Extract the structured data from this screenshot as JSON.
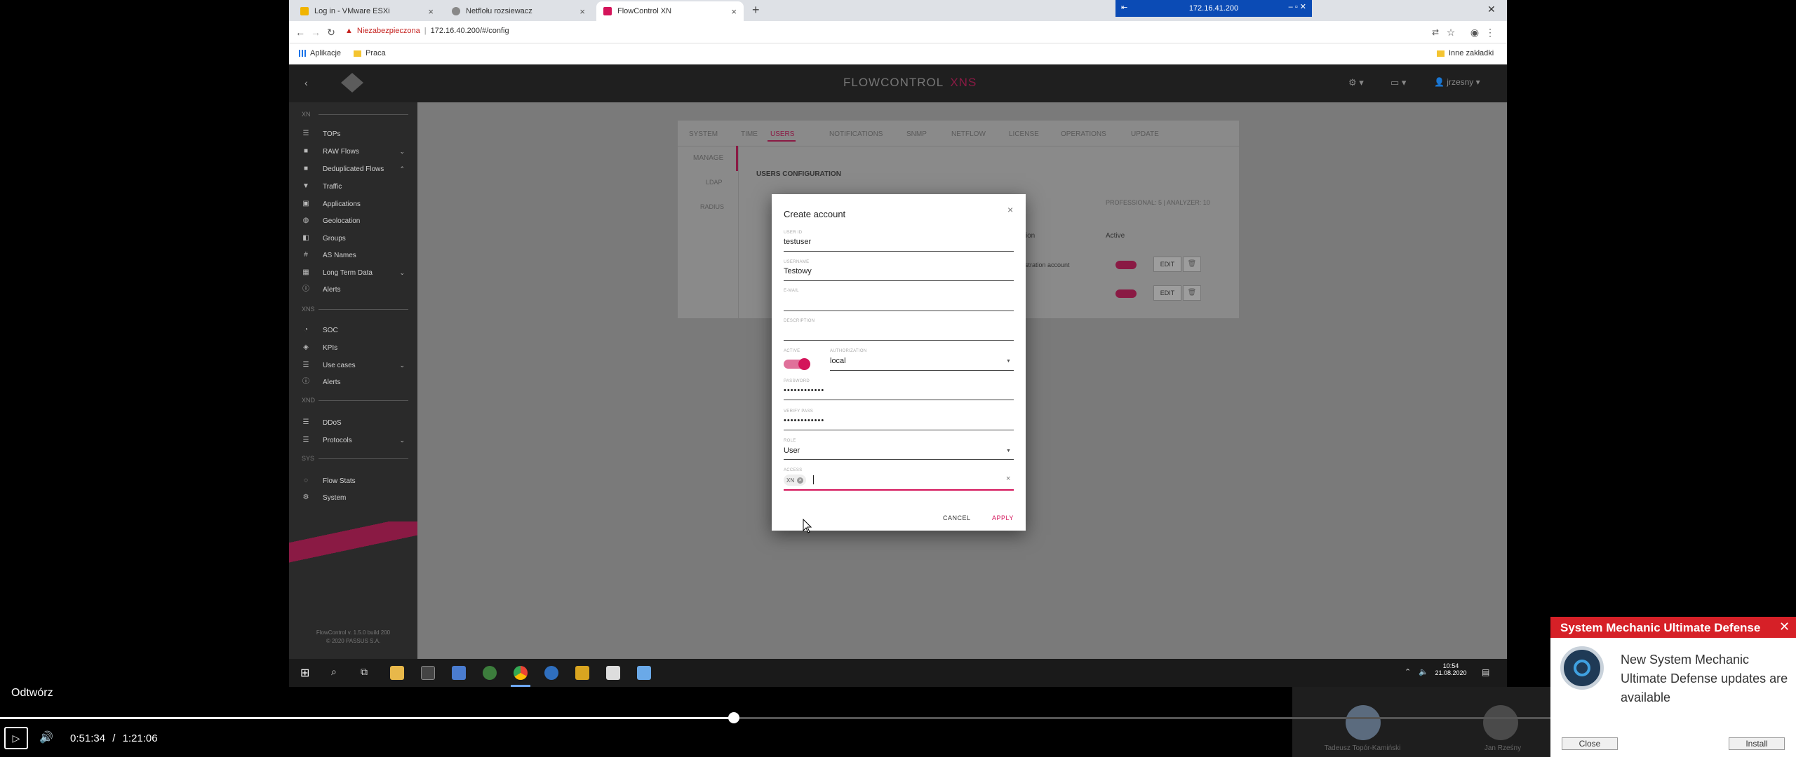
{
  "browser": {
    "tabs": [
      {
        "title": "Log in - VMware ESXi",
        "color": "#f1b400"
      },
      {
        "title": "Netflołu rozsiewacz",
        "color": "#666666"
      },
      {
        "title": "FlowControl XN",
        "color": "#d4145a"
      }
    ],
    "new_tab_symbol": "+",
    "rdp_title": "172.16.41.200",
    "security_label": "Niezabezpieczona",
    "url": "172.16.40.200/#/config",
    "bookmarks": {
      "apps": "Aplikacje",
      "folder": "Praca",
      "other": "Inne zakładki"
    }
  },
  "app": {
    "logo_main": "FLOWCONTROL",
    "logo_accent": "XNS",
    "accent_color": "#d4145a",
    "user": "jrzesny",
    "version_line1": "FlowControl v. 1.5.0 build 200",
    "version_line2": "© 2020 PASSUS S.A.",
    "sidebar": {
      "sections": [
        {
          "title": "XN",
          "items": [
            {
              "label": "TOPs",
              "icon": "list-icon",
              "chevron": ""
            },
            {
              "label": "RAW Flows",
              "icon": "box-icon",
              "chevron": "⌄"
            },
            {
              "label": "Deduplicated Flows",
              "icon": "box-icon",
              "chevron": "⌃"
            },
            {
              "label": "Traffic",
              "icon": "filter-icon",
              "chevron": ""
            },
            {
              "label": "Applications",
              "icon": "app-icon",
              "chevron": ""
            },
            {
              "label": "Geolocation",
              "icon": "globe-icon",
              "chevron": ""
            },
            {
              "label": "Groups",
              "icon": "groups-icon",
              "chevron": ""
            },
            {
              "label": "AS Names",
              "icon": "as-icon",
              "chevron": ""
            },
            {
              "label": "Long Term Data",
              "icon": "calendar-icon",
              "chevron": "⌄"
            },
            {
              "label": "Alerts",
              "icon": "alert-icon",
              "chevron": ""
            }
          ]
        },
        {
          "title": "XNS",
          "items": [
            {
              "label": "SOC",
              "icon": "soc-icon",
              "chevron": ""
            },
            {
              "label": "KPIs",
              "icon": "kpi-icon",
              "chevron": ""
            },
            {
              "label": "Use cases",
              "icon": "list-icon",
              "chevron": "⌄"
            },
            {
              "label": "Alerts",
              "icon": "alert-icon",
              "chevron": ""
            }
          ]
        },
        {
          "title": "XND",
          "items": [
            {
              "label": "DDoS",
              "icon": "list-icon",
              "chevron": ""
            },
            {
              "label": "Protocols",
              "icon": "list-icon",
              "chevron": "⌄"
            }
          ]
        },
        {
          "title": "SYS",
          "items": [
            {
              "label": "Flow Stats",
              "icon": "stats-icon",
              "chevron": ""
            },
            {
              "label": "System",
              "icon": "gear-icon",
              "chevron": ""
            }
          ]
        }
      ]
    },
    "config_tabs": [
      "SYSTEM",
      "TIME",
      "USERS",
      "NOTIFICATIONS",
      "SNMP",
      "NETFLOW",
      "LICENSE",
      "OPERATIONS",
      "UPDATE"
    ],
    "active_config_tab": "USERS",
    "subnav": [
      "MANAGE",
      "LDAP",
      "RADIUS"
    ],
    "section_title": "USERS CONFIGURATION",
    "license_info": "PROFESSIONAL: 5 | ANALYZER: 10",
    "table_headers": [
      "ription",
      "Active"
    ],
    "rows": [
      {
        "description": "inistration account",
        "edit": "EDIT"
      },
      {
        "description": "",
        "edit": "EDIT"
      }
    ]
  },
  "modal": {
    "title": "Create account",
    "close": "×",
    "user_id": {
      "label": "USER ID",
      "value": "testuser"
    },
    "username": {
      "label": "USERNAME",
      "value": "Testowy"
    },
    "email": {
      "label": "E-MAIL",
      "value": ""
    },
    "description": {
      "label": "DESCRIPTION",
      "value": ""
    },
    "active": {
      "label": "ACTIVE",
      "on": true
    },
    "authorization": {
      "label": "AUTHORIZATION",
      "value": "local"
    },
    "password": {
      "label": "PASSWORD",
      "value": "••••••••••••"
    },
    "verify": {
      "label": "VERIFY PASS",
      "value": "••••••••••••"
    },
    "role": {
      "label": "ROLE",
      "value": "User"
    },
    "access": {
      "label": "ACCESS",
      "chip": "XN"
    },
    "cancel": "CANCEL",
    "apply": "APPLY"
  },
  "taskbar": {
    "time": "10:54",
    "date": "21.08.2020"
  },
  "player": {
    "play_label": "Odtwórz",
    "current": "0:51:34",
    "separator": "/",
    "total": "1:21:06",
    "progress": 0.635,
    "participants": [
      "Tadeusz Topór-Kamiński",
      "Jan Rześny"
    ]
  },
  "notification": {
    "title": "System Mechanic Ultimate Defense",
    "message": "New System Mechanic Ultimate Defense updates are available",
    "close_btn": "Close",
    "install_btn": "Install",
    "color": "#d62027"
  }
}
